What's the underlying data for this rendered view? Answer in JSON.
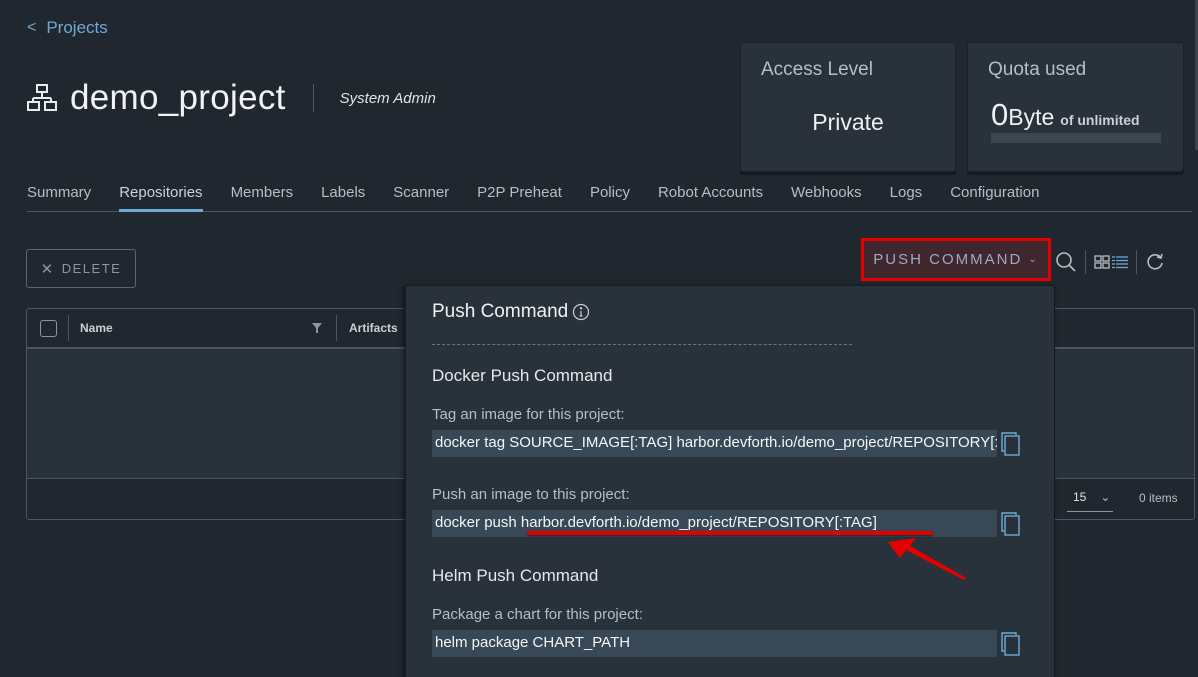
{
  "breadcrumb": {
    "chevron": "<",
    "label": "Projects"
  },
  "project": {
    "icon": "project-tree-icon",
    "name": "demo_project",
    "role": "System Admin"
  },
  "cards": {
    "access": {
      "title": "Access Level",
      "value": "Private"
    },
    "quota": {
      "title": "Quota used",
      "used_num": "0",
      "used_unit": "Byte",
      "of_text": "of unlimited",
      "fill_fraction": 0
    }
  },
  "tabs": [
    {
      "label": "Summary",
      "active": false
    },
    {
      "label": "Repositories",
      "active": true
    },
    {
      "label": "Members",
      "active": false
    },
    {
      "label": "Labels",
      "active": false
    },
    {
      "label": "Scanner",
      "active": false
    },
    {
      "label": "P2P Preheat",
      "active": false
    },
    {
      "label": "Policy",
      "active": false
    },
    {
      "label": "Robot Accounts",
      "active": false
    },
    {
      "label": "Webhooks",
      "active": false
    },
    {
      "label": "Logs",
      "active": false
    },
    {
      "label": "Configuration",
      "active": false
    }
  ],
  "toolbar": {
    "delete_label": "DELETE",
    "push_command_label": "PUSH COMMAND",
    "icons": [
      "search-icon",
      "card-view-icon",
      "list-view-icon",
      "refresh-icon"
    ]
  },
  "grid": {
    "columns": [
      "Name",
      "Artifacts"
    ],
    "page_size": "15",
    "items_count": "0 items"
  },
  "push_popover": {
    "title": "Push Command",
    "docker_section": "Docker Push Command",
    "tag_label": "Tag an image for this project:",
    "tag_command": "docker tag SOURCE_IMAGE[:TAG] harbor.devforth.io/demo_project/REPOSITORY[:TAG]",
    "push_label": "Push an image to this project:",
    "push_command": "docker push harbor.devforth.io/demo_project/REPOSITORY[:TAG]",
    "helm_section": "Helm Push Command",
    "package_label": "Package a chart for this project:",
    "package_command": "helm package CHART_PATH"
  },
  "colors": {
    "accent": "#6ea9d6",
    "background": "#21272e",
    "panel": "#29323a",
    "annotation_red": "#e50000"
  }
}
